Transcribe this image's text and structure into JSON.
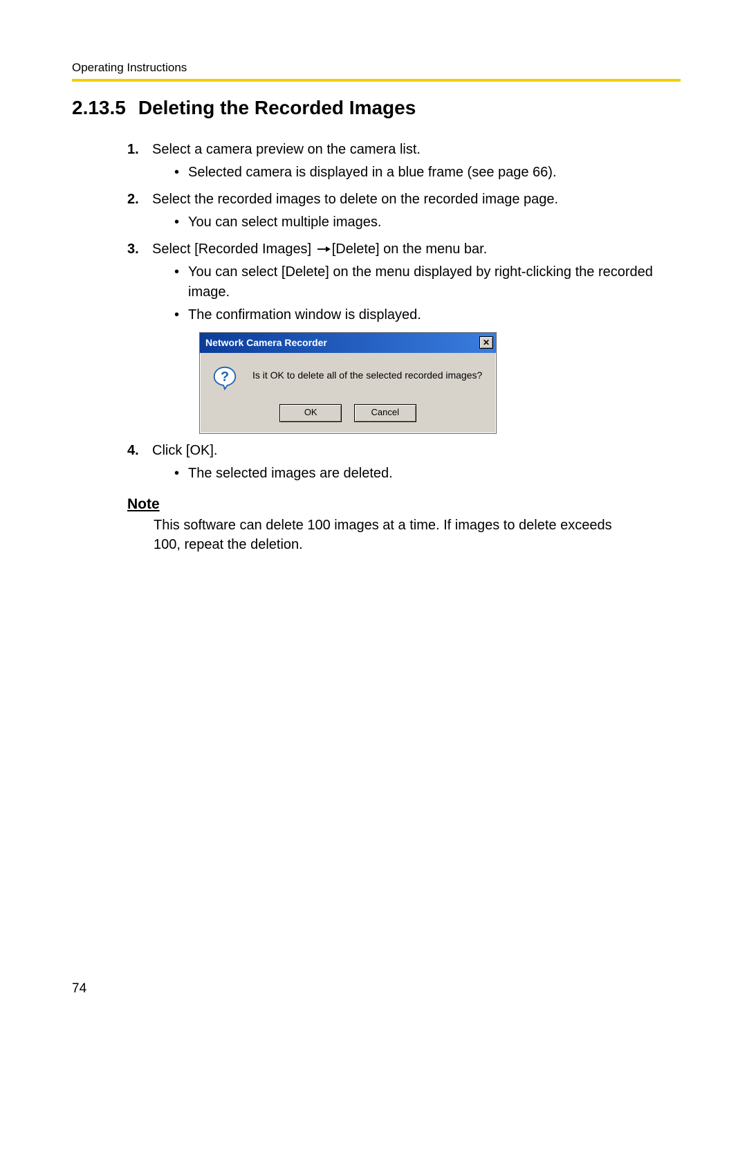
{
  "header_label": "Operating Instructions",
  "section_number": "2.13.5",
  "section_title": "Deleting the Recorded Images",
  "steps": [
    {
      "num": "1.",
      "text": "Select a camera preview on the camera list.",
      "sub": [
        "Selected camera is displayed in a blue frame (see page 66)."
      ]
    },
    {
      "num": "2.",
      "text": "Select the recorded images to delete on the recorded image page.",
      "sub": [
        "You can select multiple images."
      ]
    },
    {
      "num": "3.",
      "text_pre": "Select [Recorded Images]",
      "text_post": "[Delete] on the menu bar.",
      "sub": [
        "You can select [Delete] on the menu displayed by right-clicking the recorded image.",
        "The confirmation window is displayed."
      ]
    },
    {
      "num": "4.",
      "text": "Click [OK].",
      "sub": [
        "The selected images are deleted."
      ]
    }
  ],
  "dialog": {
    "title": "Network Camera Recorder",
    "close_glyph": "✕",
    "message": "Is it OK to delete all of the selected recorded images?",
    "ok": "OK",
    "cancel": "Cancel"
  },
  "note_label": "Note",
  "note_body": "This software can delete 100 images at a time. If images to delete exceeds 100, repeat the deletion.",
  "page_number": "74"
}
